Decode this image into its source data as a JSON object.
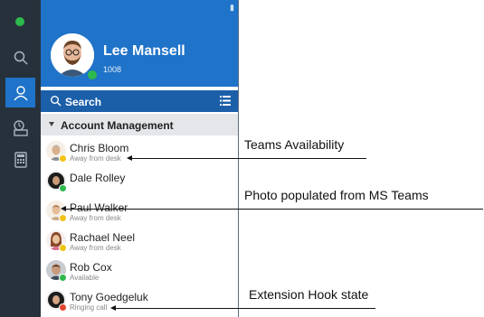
{
  "user": {
    "name": "Lee Mansell",
    "extension": "1008",
    "presence_color": "#2db94d"
  },
  "search": {
    "label": "Search"
  },
  "group": {
    "label": "Account Management"
  },
  "contacts": [
    {
      "name": "Chris Bloom",
      "status": "Away from desk",
      "presence_color": "#f2c314"
    },
    {
      "name": "Dale Rolley",
      "status": "",
      "presence_color": "#2db94d"
    },
    {
      "name": "Paul Walker",
      "status": "Away from desk",
      "presence_color": "#f2c314"
    },
    {
      "name": "Rachael Neel",
      "status": "Away from desk",
      "presence_color": "#f2c314"
    },
    {
      "name": "Rob Cox",
      "status": "Available",
      "presence_color": "#2db94d"
    },
    {
      "name": "Tony Goedgeluk",
      "status": "Ringing call",
      "presence_color": "#e3442e"
    }
  ],
  "annotations": {
    "teams_availability": "Teams Availability",
    "photo_populated": "Photo populated from MS Teams",
    "extension_hook": "Extension Hook state"
  },
  "colors": {
    "accent": "#1f73c8",
    "rail": "#27313c",
    "search_bar": "#1b5fa9"
  },
  "icons": [
    "status-dot-icon",
    "search-icon",
    "contacts-icon",
    "voicemail-icon",
    "dialpad-icon",
    "pin-icon",
    "list-view-icon",
    "collapse-triangle-icon"
  ]
}
